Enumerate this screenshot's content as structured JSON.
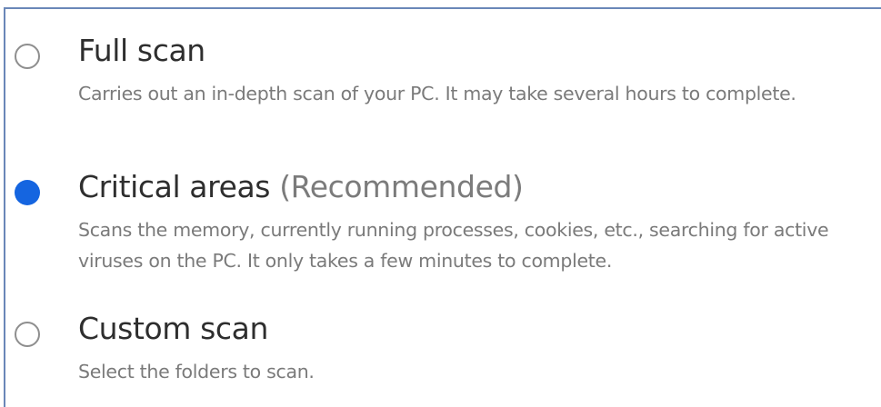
{
  "options": [
    {
      "title": "Full scan",
      "recommended": "",
      "description": "Carries out an in-depth scan of your PC. It may take several hours to complete.",
      "selected": false
    },
    {
      "title": "Critical areas",
      "recommended": "(Recommended)",
      "description": "Scans the memory, currently running processes, cookies, etc., searching for active viruses on the PC. It only takes a few minutes to complete.",
      "selected": true
    },
    {
      "title": "Custom scan",
      "recommended": "",
      "description": "Select the folders to scan.",
      "selected": false
    }
  ],
  "colors": {
    "accent": "#1565e0",
    "frame": "#6a87b8",
    "title": "#2e2e2e",
    "description": "#7a7a7a"
  }
}
